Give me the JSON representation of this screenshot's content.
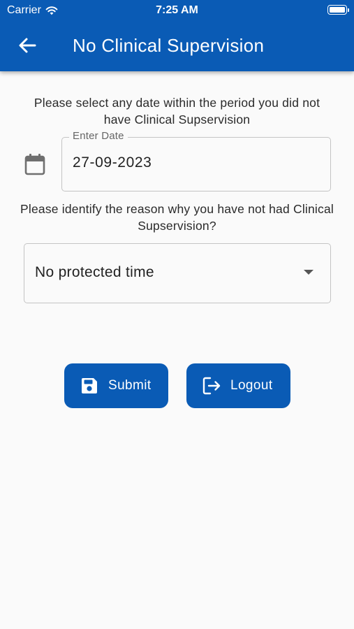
{
  "status_bar": {
    "carrier": "Carrier",
    "time": "7:25 AM",
    "wifi_icon": "wifi-icon",
    "battery_icon": "battery-icon"
  },
  "header": {
    "title": "No Clinical Supervision",
    "back_icon": "arrow-left-icon",
    "background_color": "#0a5bb5"
  },
  "date_section": {
    "prompt": "Please select any date within the period you did not have Clinical Supservision",
    "calendar_icon": "calendar-icon",
    "label": "Enter Date",
    "value": "27-09-2023"
  },
  "reason_section": {
    "prompt": "Please identify the reason why you have not had Clinical Supservision?",
    "selected": "No protected time",
    "caret_icon": "caret-down-icon"
  },
  "actions": {
    "submit_label": "Submit",
    "submit_icon": "save-icon",
    "logout_label": "Logout",
    "logout_icon": "logout-icon",
    "button_color": "#0a5bb5"
  }
}
